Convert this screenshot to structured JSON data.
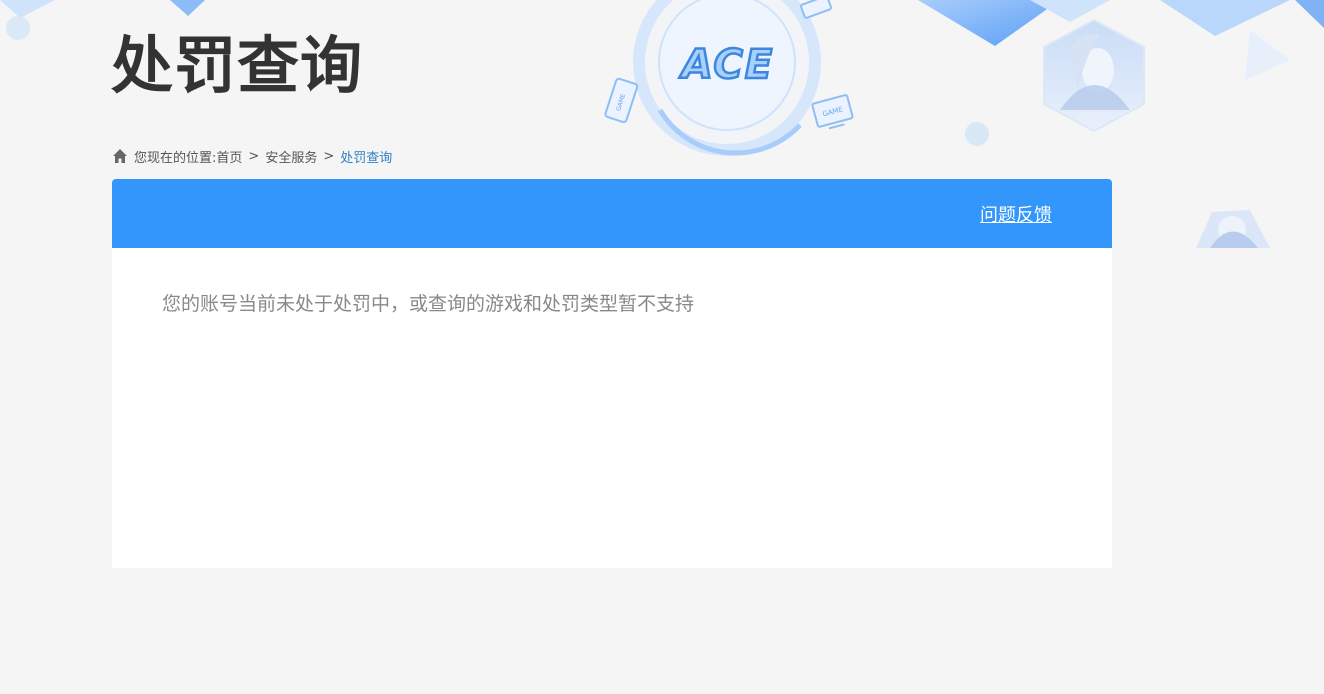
{
  "logo_text": "ACE",
  "decor_device_labels": [
    "GAME",
    "GAME"
  ],
  "page_title": "处罚查询",
  "breadcrumb": {
    "prefix": "您现在的位置:",
    "items": [
      "首页",
      "安全服务",
      "处罚查询"
    ],
    "separator": ">"
  },
  "panel": {
    "feedback_label": "问题反馈",
    "message": "您的账号当前未处于处罚中，或查询的游戏和处罚类型暂不支持"
  },
  "colors": {
    "header_blue": "#3396fb",
    "title": "#333333",
    "breadcrumb_current": "#2f7fc4",
    "message": "#888888"
  }
}
